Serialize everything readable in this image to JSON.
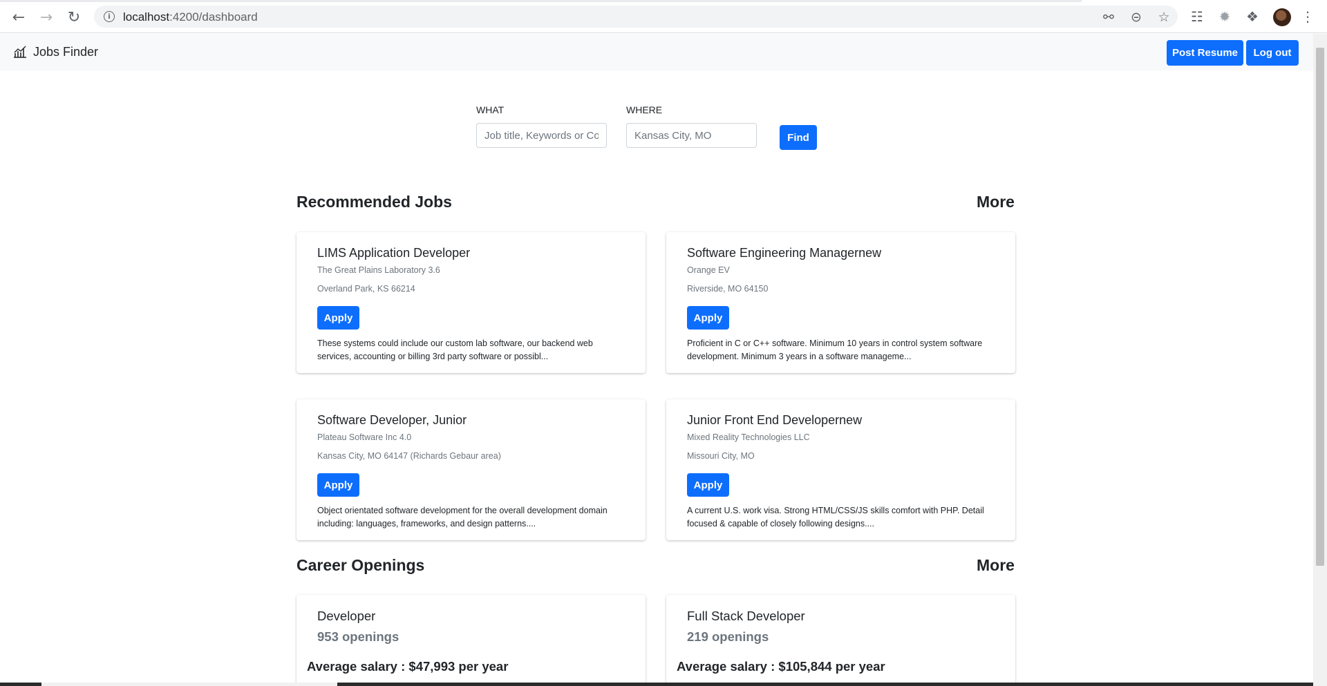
{
  "browser": {
    "url_host": "localhost",
    "url_path": ":4200/dashboard",
    "icons": [
      "back-arrow-icon",
      "forward-arrow-icon",
      "reload-icon",
      "info-icon",
      "key-icon",
      "zoom-out-icon",
      "star-icon",
      "globe-extension-icon",
      "extension-icon",
      "puzzle-icon",
      "menu-dots-icon"
    ]
  },
  "navbar": {
    "brand": "Jobs Finder",
    "post_resume": "Post Resume",
    "logout": "Log out"
  },
  "search": {
    "what_label": "WHAT",
    "what_placeholder": "Job title, Keywords or Company",
    "where_label": "WHERE",
    "where_placeholder": "Kansas City, MO",
    "find": "Find"
  },
  "recommended": {
    "title": "Recommended Jobs",
    "more": "More",
    "jobs": [
      {
        "title": "LIMS Application Developer",
        "company": "The Great Plains Laboratory   3.6",
        "location": "Overland Park, KS 66214",
        "apply": "Apply",
        "description": "These systems could include our custom lab software, our backend web services, accounting or billing 3rd party software or possibl..."
      },
      {
        "title": "Software Engineering Managernew",
        "company": "Orange EV",
        "location": "Riverside, MO 64150",
        "apply": "Apply",
        "description": "Proficient in C or C++ software. Minimum 10 years in control system software development. Minimum 3 years in a software manageme..."
      },
      {
        "title": "Software Developer, Junior",
        "company": "Plateau Software Inc   4.0",
        "location": "Kansas City, MO 64147 (Richards Gebaur area)",
        "apply": "Apply",
        "description": "Object orientated software development for the overall development domain including: languages, frameworks, and design patterns...."
      },
      {
        "title": "Junior Front End Developernew",
        "company": "Mixed Reality Technologies LLC",
        "location": "Missouri City, MO",
        "apply": "Apply",
        "description": "A current U.S. work visa. Strong HTML/CSS/JS skills comfort with PHP. Detail focused & capable of closely following designs...."
      }
    ]
  },
  "careers": {
    "title": "Career Openings",
    "more": "More",
    "items": [
      {
        "title": "Developer",
        "openings": "953 openings",
        "salary": "Average salary :  $47,993 per year"
      },
      {
        "title": "Full Stack Developer",
        "openings": "219 openings",
        "salary": "Average salary :  $105,844 per year"
      }
    ]
  },
  "colors": {
    "primary": "#0d6efd",
    "navbar_bg": "#f8f9fa",
    "muted_text": "#6c757d"
  }
}
